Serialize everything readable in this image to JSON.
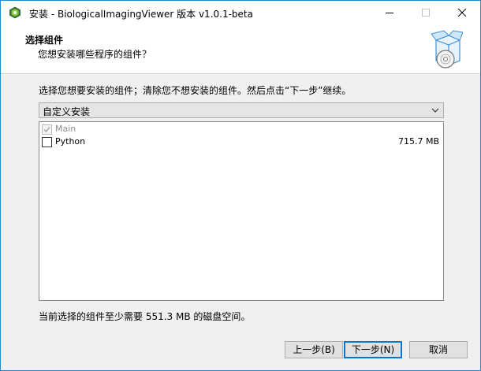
{
  "window": {
    "title": "安装 - BiologicalImagingViewer 版本 v1.0.1-beta",
    "accent_color": "#1c8ad8"
  },
  "header": {
    "title": "选择组件",
    "subtitle": "您想安装哪些程序的组件？",
    "icon": "setup-box-disc-icon"
  },
  "instruction": "选择您想要安装的组件；清除您不想安装的组件。然后点击“下一步”继续。",
  "install_type": {
    "selected": "自定义安装"
  },
  "components": [
    {
      "label": "Main",
      "checked": true,
      "disabled": true,
      "size": ""
    },
    {
      "label": "Python",
      "checked": false,
      "disabled": false,
      "size": "715.7 MB"
    }
  ],
  "space_required": "当前选择的组件至少需要 551.3 MB 的磁盘空间。",
  "buttons": {
    "back": "上一步(B)",
    "next": "下一步(N)",
    "cancel": "取消"
  }
}
